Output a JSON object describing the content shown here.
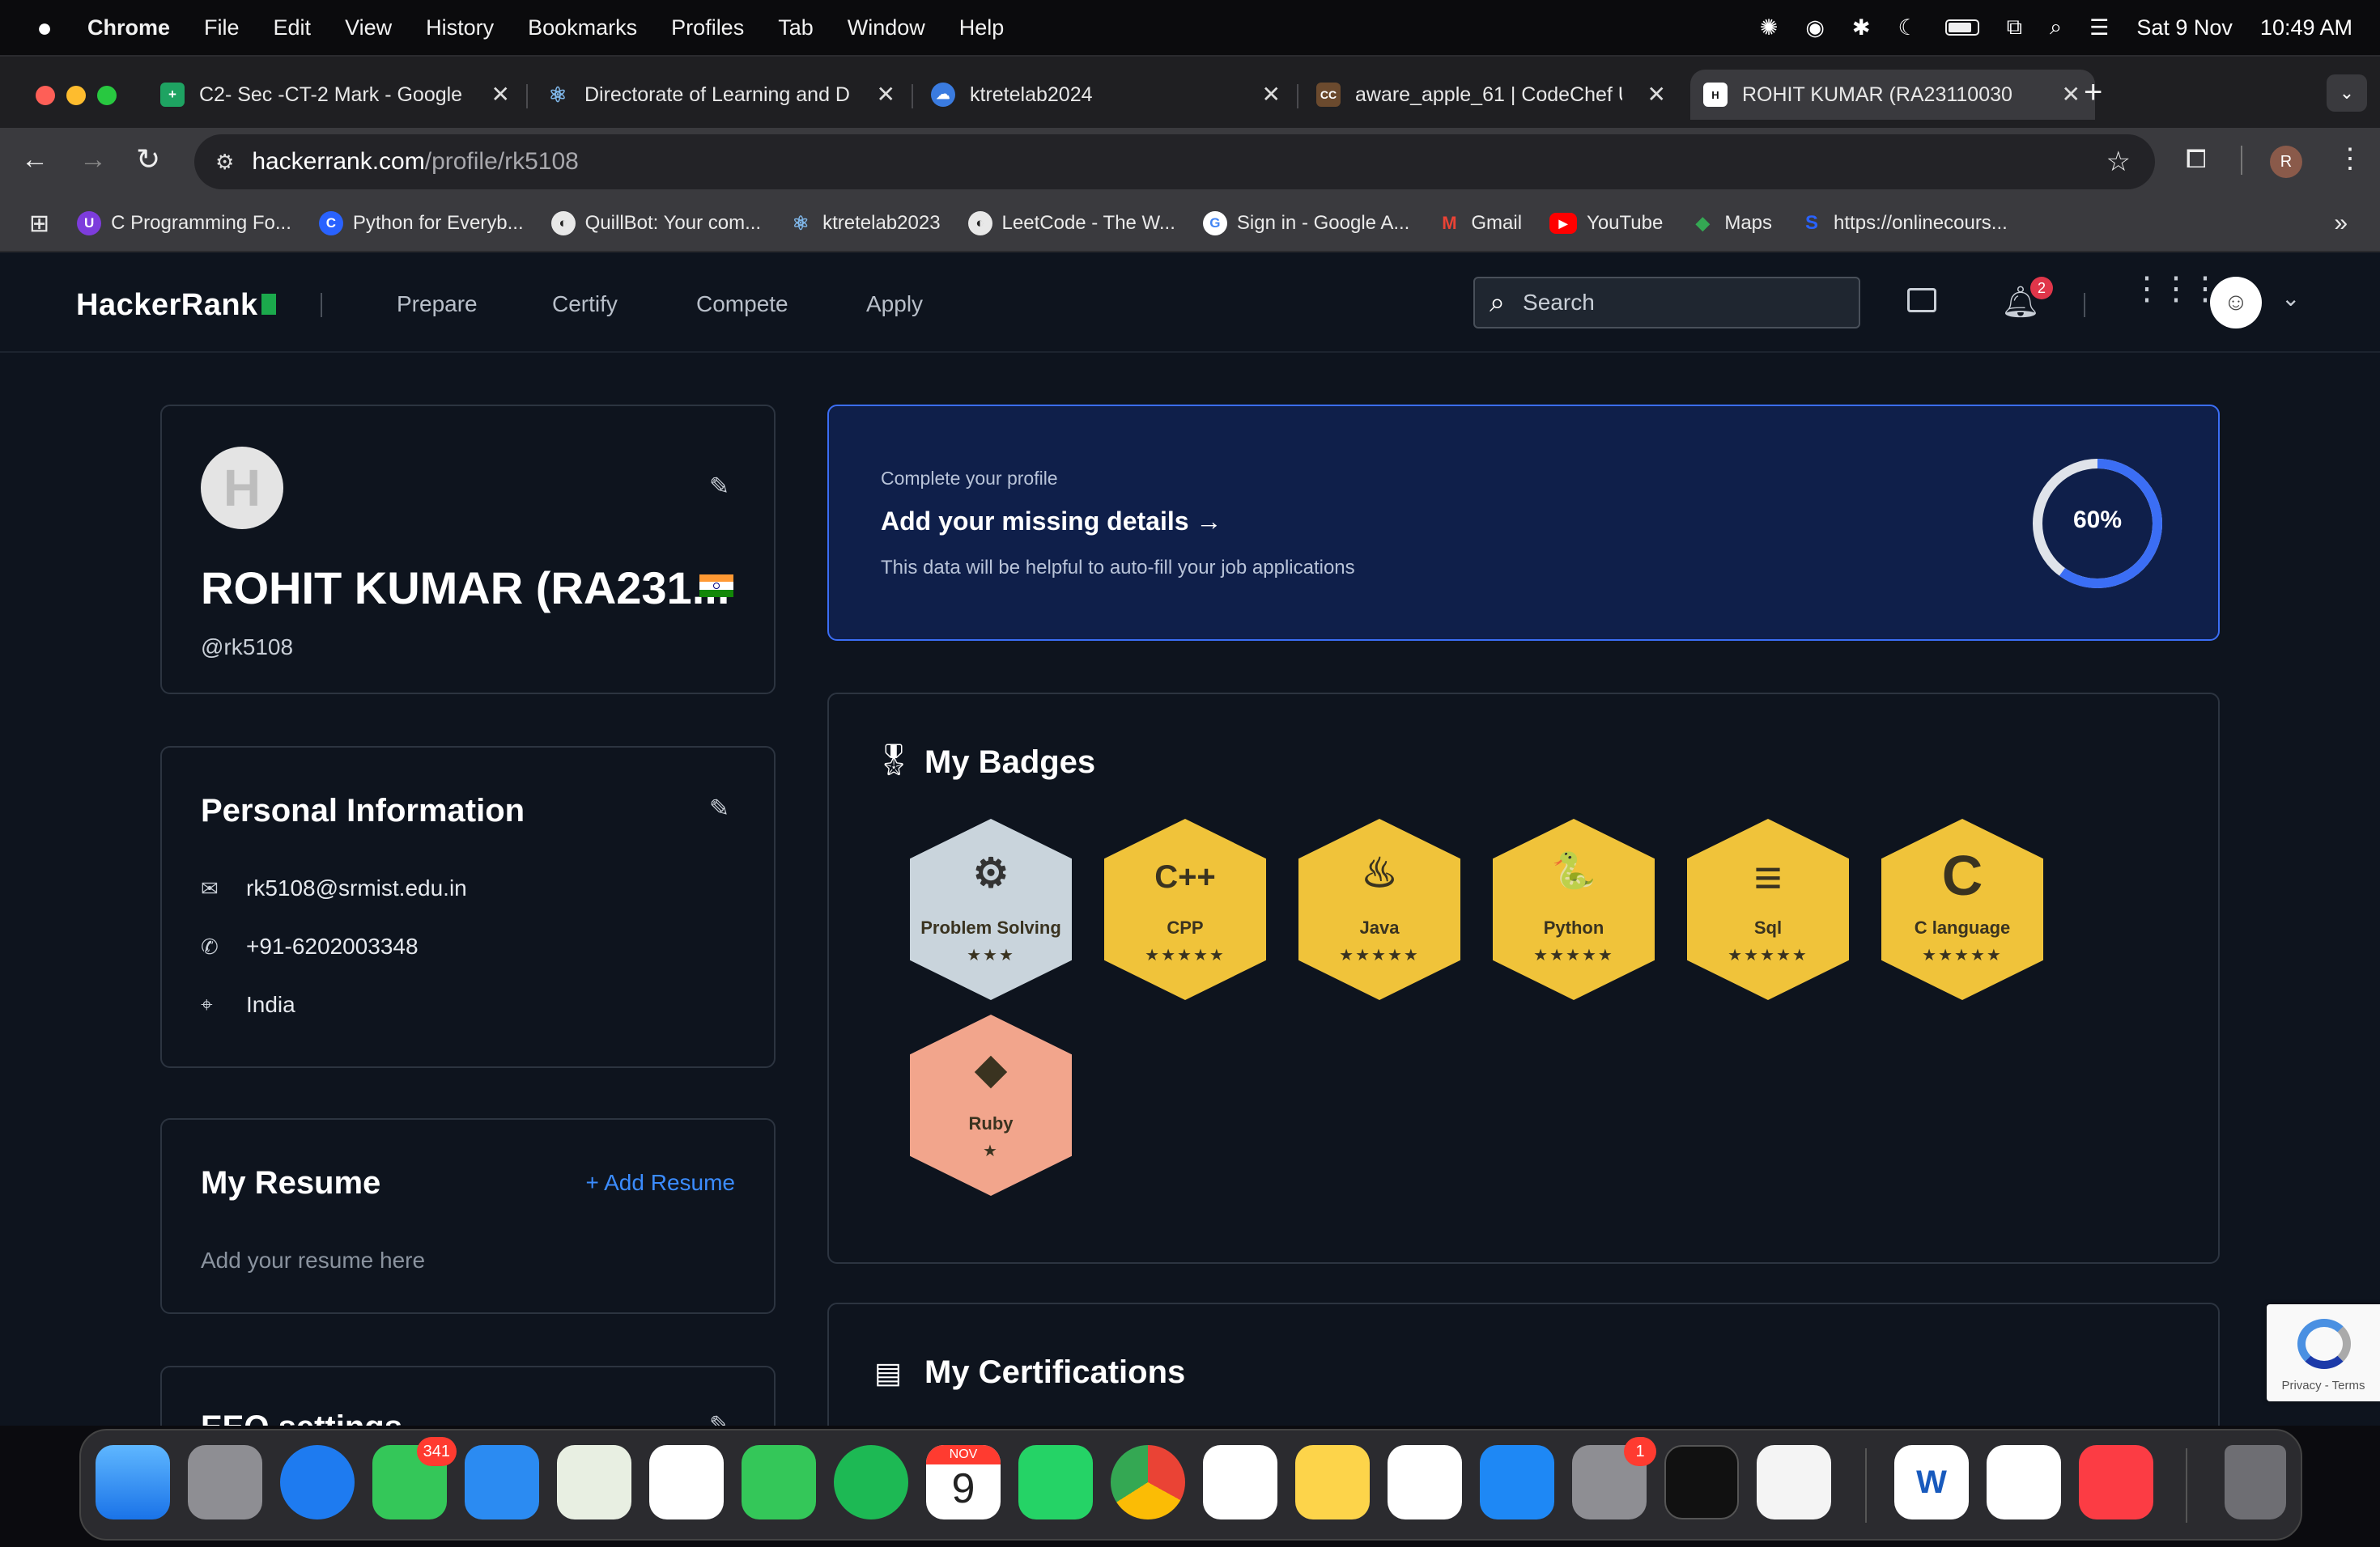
{
  "menubar": {
    "app": "Chrome",
    "items": [
      "File",
      "Edit",
      "View",
      "History",
      "Bookmarks",
      "Profiles",
      "Tab",
      "Window",
      "Help"
    ],
    "date": "Sat 9 Nov",
    "time": "10:49 AM"
  },
  "tabs": [
    {
      "title": "C2- Sec -CT-2 Mark - Google",
      "icon": "sheets-icon",
      "color": "#1ea362"
    },
    {
      "title": "Directorate of Learning and D",
      "icon": "react-icon",
      "color": "#7fb6e8"
    },
    {
      "title": "ktretelab2024",
      "icon": "cloud-icon",
      "color": "#3a7be0"
    },
    {
      "title": "aware_apple_61 | CodeChef U",
      "icon": "codechef-icon",
      "color": "#6b4a2e"
    },
    {
      "title": "ROHIT KUMAR (RA23110030",
      "icon": "hackerrank-icon",
      "color": "#1ba94c"
    }
  ],
  "address": {
    "domain": "hackerrank.com",
    "path": "/profile/rk5108"
  },
  "bookmarks": [
    {
      "label": "C Programming Fo...",
      "color": "#7d3cdc",
      "glyph": "U"
    },
    {
      "label": "Python for Everyb...",
      "color": "#2962ff",
      "glyph": "C"
    },
    {
      "label": "QuillBot: Your com...",
      "color": "#e8e8e8",
      "glyph": "◐"
    },
    {
      "label": "ktretelab2023",
      "color": "#7fb6e8",
      "glyph": "⚛"
    },
    {
      "label": "LeetCode - The W...",
      "color": "#e8e8e8",
      "glyph": "◐"
    },
    {
      "label": "Sign in - Google A...",
      "color": "#ffffff",
      "glyph": "G"
    },
    {
      "label": "Gmail",
      "color": "#ea4335",
      "glyph": "M"
    },
    {
      "label": "YouTube",
      "color": "#ff0000",
      "glyph": "▶"
    },
    {
      "label": "Maps",
      "color": "#34a853",
      "glyph": "◆"
    },
    {
      "label": "https://onlinecours...",
      "color": "#2962ff",
      "glyph": "S"
    }
  ],
  "hr": {
    "logo": "HackerRank",
    "nav": [
      "Prepare",
      "Certify",
      "Compete",
      "Apply"
    ],
    "search_placeholder": "Search",
    "notifications": "2"
  },
  "profile": {
    "avatar_letter": "H",
    "name": "ROHIT KUMAR (RA231...",
    "handle": "@rk5108",
    "flag": "India"
  },
  "personal": {
    "title": "Personal Information",
    "email": "rk5108@srmist.edu.in",
    "phone": "+91-6202003348",
    "country": "India"
  },
  "resume": {
    "title": "My Resume",
    "add": "+ Add Resume",
    "placeholder": "Add your resume here"
  },
  "eeo_partial": "EEO settings",
  "banner": {
    "kicker": "Complete your profile",
    "heading": "Add your missing details",
    "sub": "This data will be helpful to auto-fill your job applications",
    "percent_label": "60%",
    "progress": 0.6
  },
  "badges_title": "My Badges",
  "badges": [
    {
      "name": "Problem Solving",
      "symbol": "⚙",
      "stars": "★★★",
      "color": "#c9d4dc",
      "star_count": 3
    },
    {
      "name": "CPP",
      "symbol": "C++",
      "stars": "★★★★★",
      "color": "#f0c33a",
      "star_count": 5
    },
    {
      "name": "Java",
      "symbol": "♨",
      "stars": "★★★★★",
      "color": "#f0c33a",
      "star_count": 5
    },
    {
      "name": "Python",
      "symbol": "🐍",
      "stars": "★★★★★",
      "color": "#f0c33a",
      "star_count": 5
    },
    {
      "name": "Sql",
      "symbol": "≡",
      "stars": "★★★★★",
      "color": "#f0c33a",
      "star_count": 5
    },
    {
      "name": "C language",
      "symbol": "C",
      "stars": "★★★★★",
      "color": "#f0c33a",
      "star_count": 5
    },
    {
      "name": "Ruby",
      "symbol": "◆",
      "stars": "★",
      "color": "#f2a58c",
      "star_count": 1
    }
  ],
  "certs_title": "My Certifications",
  "recaptcha": "Privacy - Terms",
  "dock": {
    "messages_badge": "341",
    "calendar_month": "NOV",
    "calendar_day": "9",
    "settings_badge": "1",
    "word_glyph": "W"
  },
  "colors": {
    "accent": "#3b6ef5",
    "hr_green": "#1ba94c",
    "gold": "#f0c33a"
  }
}
